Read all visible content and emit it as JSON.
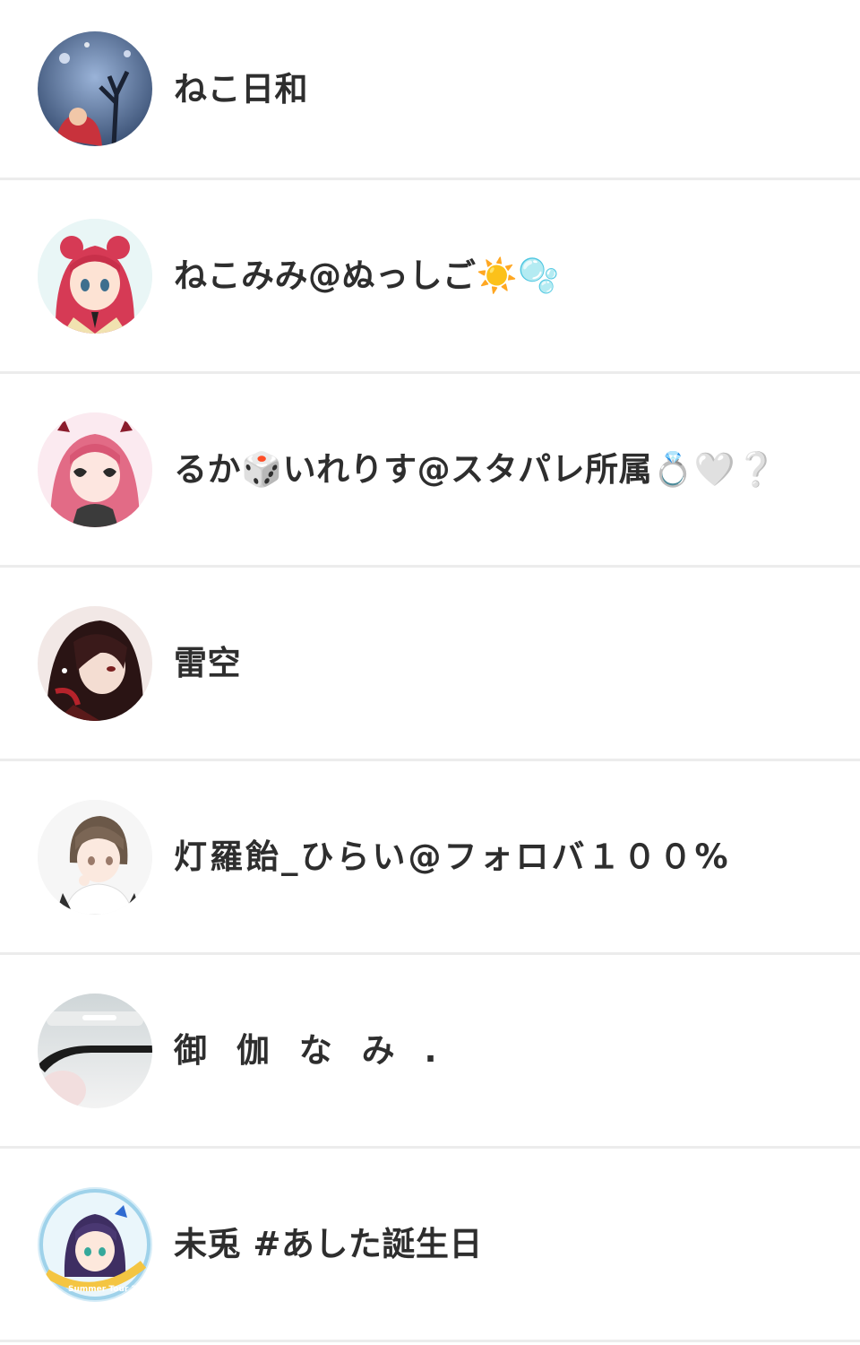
{
  "users": [
    {
      "name": "ねこ日和",
      "avatar_icon": "avatar-snowy-tree-icon"
    },
    {
      "name": "ねこみみ@ぬっしご☀️🫧",
      "avatar_icon": "avatar-red-hair-girl-icon"
    },
    {
      "name": "るか🎲いれりす@スタパレ所属💍🤍❔",
      "avatar_icon": "avatar-pink-hair-sunglasses-icon"
    },
    {
      "name": "雷空",
      "avatar_icon": "avatar-dark-hair-boy-icon"
    },
    {
      "name": "灯羅飴_ひらい@フォロバ１００%",
      "avatar_icon": "avatar-brown-hair-boy-icon"
    },
    {
      "name": "御 伽 な み .",
      "avatar_icon": "avatar-blurred-photo-icon"
    },
    {
      "name": "未兎 #あした誕生日",
      "avatar_icon": "avatar-summer-tour-badge-icon"
    }
  ],
  "avatar_badge_text": "Summer Tour 2023",
  "colors": {
    "background": "#ffffff",
    "divider": "#ececec",
    "text": "#2e2e2e"
  }
}
